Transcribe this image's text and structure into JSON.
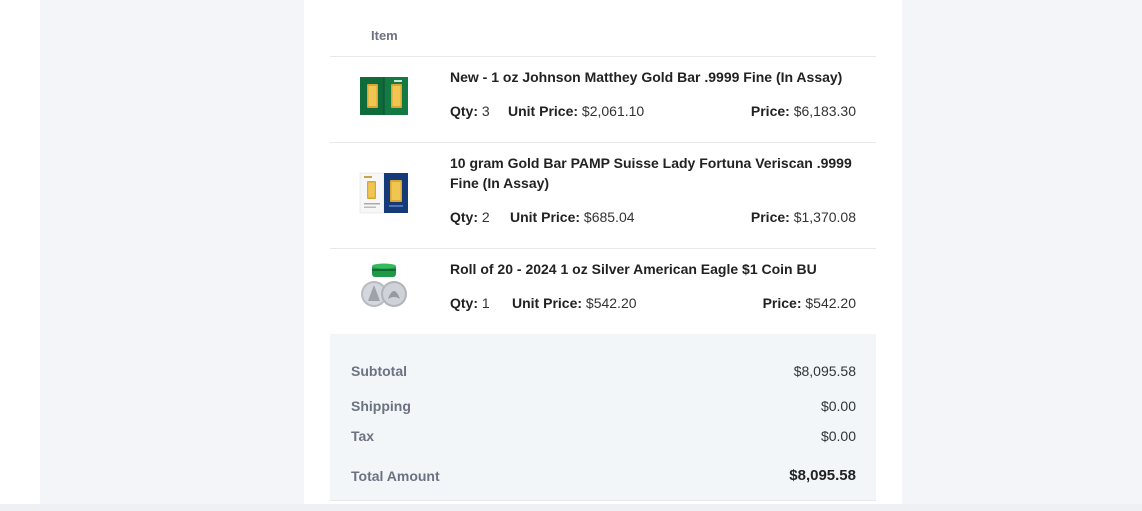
{
  "table": {
    "header_item": "Item"
  },
  "items": [
    {
      "name": "New - 1 oz Johnson Matthey Gold Bar .9999 Fine (In Assay)",
      "qty_label": "Qty:",
      "qty": "3",
      "unit_price_label": "Unit Price:",
      "unit_price": "$2,061.10",
      "price_label": "Price:",
      "price": "$6,183.30",
      "icon": "gold-bar-assay-green-icon"
    },
    {
      "name": "10 gram Gold Bar PAMP Suisse Lady Fortuna Veriscan .9999 Fine (In Assay)",
      "qty_label": "Qty:",
      "qty": "2",
      "unit_price_label": "Unit Price:",
      "unit_price": "$685.04",
      "price_label": "Price:",
      "price": "$1,370.08",
      "icon": "gold-bar-assay-blue-icon"
    },
    {
      "name": "Roll of 20 - 2024 1 oz Silver American Eagle $1 Coin BU",
      "qty_label": "Qty:",
      "qty": "1",
      "unit_price_label": "Unit Price:",
      "unit_price": "$542.20",
      "price_label": "Price:",
      "price": "$542.20",
      "icon": "silver-coin-roll-icon"
    }
  ],
  "summary": {
    "subtotal_label": "Subtotal",
    "subtotal": "$8,095.58",
    "shipping_label": "Shipping",
    "shipping": "$0.00",
    "tax_label": "Tax",
    "tax": "$0.00",
    "total_label": "Total Amount",
    "total": "$8,095.58"
  },
  "colors": {
    "page_bg": "#f4f5f8",
    "card_bg": "#ffffff",
    "summary_bg": "#f3f6f9",
    "muted_label": "#6b7280"
  }
}
